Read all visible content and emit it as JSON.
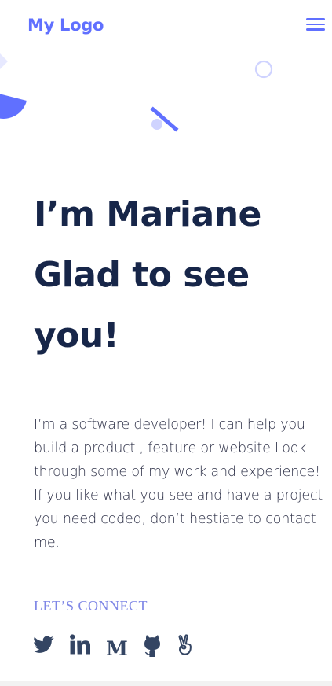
{
  "header": {
    "logo": "My Logo",
    "menu_icon": "hamburger-menu-icon"
  },
  "hero": {
    "headline_line1": "I’m Mariane",
    "headline_line2": "Glad to see",
    "headline_line3": "you!",
    "intro": "I’m a software developer! I can help you build a product , feature or website Look through some of my work and experience! If you like what you see and have a project you need coded, don’t hestiate to contact me.",
    "cta": "LET’S CONNECT"
  },
  "socials": [
    {
      "icon": "twitter-icon"
    },
    {
      "icon": "linkedin-icon"
    },
    {
      "icon": "medium-icon"
    },
    {
      "icon": "github-icon"
    },
    {
      "icon": "angellist-icon"
    }
  ],
  "colors": {
    "brand": "#6070ff",
    "heading": "#172649",
    "body_text": "#2e3148",
    "link": "#7f87e6",
    "icon": "#344563"
  }
}
